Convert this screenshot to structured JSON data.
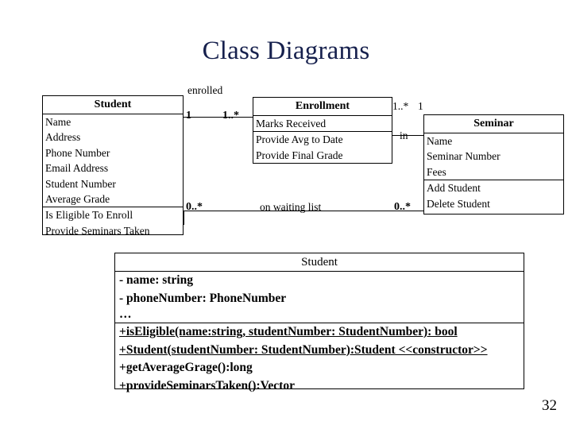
{
  "slide": {
    "title": "Class Diagrams",
    "page_number": "32",
    "title_color": "#16204d"
  },
  "classes": {
    "student": {
      "name": "Student",
      "attributes": [
        "Name",
        "Address",
        "Phone Number",
        "Email Address",
        "Student Number",
        "Average Grade"
      ],
      "operations": [
        "Is Eligible To Enroll",
        "Provide Seminars Taken"
      ]
    },
    "enrollment": {
      "name": "Enrollment",
      "attributes": [
        "Marks Received"
      ],
      "operations": [
        "Provide Avg to Date",
        "Provide Final Grade"
      ]
    },
    "seminar": {
      "name": "Seminar",
      "attributes": [
        "Name",
        "Seminar Number",
        "Fees"
      ],
      "operations": [
        "Add Student",
        "Delete Student"
      ]
    },
    "student_detailed": {
      "name": "Student",
      "attributes": [
        "- name: string",
        "- phoneNumber: PhoneNumber",
        "…"
      ],
      "operations": [
        "+isEligible(name:string, studentNumber: StudentNumber): bool",
        "+Student(studentNumber: StudentNumber):Student <<constructor>>",
        "+getAverageGrage():long",
        "+provideSeminarsTaken():Vector"
      ]
    }
  },
  "associations": {
    "enrolled": {
      "label": "enrolled",
      "source_multiplicity": "1",
      "target_multiplicity": "1..*"
    },
    "in": {
      "label": "in",
      "source_multiplicity": "1..*",
      "target_multiplicity": "1"
    },
    "waiting_list": {
      "label": "on waiting list",
      "source_multiplicity": "0..*",
      "target_multiplicity": "0..*"
    }
  }
}
